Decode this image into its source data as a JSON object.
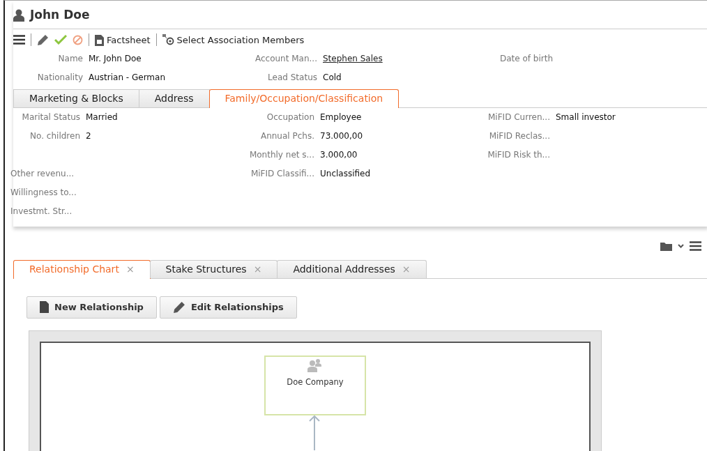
{
  "header": {
    "title": "John Doe"
  },
  "toolbar": [
    {
      "kind": "menu"
    },
    {
      "kind": "separator"
    },
    {
      "kind": "edit"
    },
    {
      "kind": "save"
    },
    {
      "kind": "cancel"
    },
    {
      "kind": "separator"
    },
    {
      "kind": "factsheet",
      "label": "Factsheet"
    },
    {
      "kind": "separator"
    },
    {
      "kind": "members",
      "label": "Select Association Members"
    }
  ],
  "header_fields": [
    [
      {
        "kind": "field",
        "label": "Name",
        "value": "Mr. John Doe"
      },
      {
        "kind": "link",
        "label": "Account Man...",
        "value": "Stephen Sales"
      },
      {
        "kind": "field",
        "label": "Date of birth"
      }
    ],
    [
      {
        "kind": "field",
        "label": "Nationality",
        "value": "Austrian - German"
      },
      {
        "kind": "field",
        "label": "Lead Status",
        "value": "Cold"
      },
      {
        "kind": "empty"
      }
    ]
  ],
  "detail_tabs": [
    {
      "label": "Marketing & Blocks",
      "selected": false
    },
    {
      "label": "Address",
      "selected": false
    },
    {
      "label": "Family/Occupation/Classification",
      "selected": true
    }
  ],
  "detail_fields": [
    [
      {
        "kind": "field",
        "label": "Marital Status",
        "value": "Married"
      },
      {
        "kind": "field",
        "label": "Occupation",
        "value": "Employee"
      },
      {
        "kind": "field",
        "label": "MiFID Curren...",
        "value": "Small investor"
      }
    ],
    [
      {
        "kind": "field",
        "label": "No. children",
        "value": "2"
      },
      {
        "kind": "field",
        "label": "Annual Pchs.",
        "value": "73.000,00"
      },
      {
        "kind": "field",
        "label": "MiFID Reclas..."
      }
    ],
    [
      {
        "kind": "empty"
      },
      {
        "kind": "field",
        "label": "Monthly net s...",
        "value": "3.000,00"
      },
      {
        "kind": "field",
        "label": "MiFID Risk th..."
      }
    ],
    [
      {
        "kind": "wide_label",
        "label": "Other revenu..."
      },
      {
        "kind": "field",
        "label": "MiFID Classifi...",
        "value": "Unclassified"
      },
      {
        "kind": "empty"
      }
    ],
    [
      {
        "kind": "wide_label",
        "label": "Willingness to..."
      },
      {
        "kind": "empty"
      },
      {
        "kind": "empty"
      }
    ],
    [
      {
        "kind": "wide_label",
        "label": "Investmt. Str..."
      },
      {
        "kind": "empty"
      },
      {
        "kind": "empty"
      }
    ]
  ],
  "related_tabs": [
    {
      "label": "Relationship Chart",
      "selected": true,
      "close": "×"
    },
    {
      "label": "Stake Structures",
      "selected": false,
      "close": "×"
    },
    {
      "label": "Additional Addresses",
      "selected": false,
      "close": "×"
    }
  ],
  "actions": [
    {
      "kind": "new",
      "label": "New Relationship"
    },
    {
      "kind": "edit",
      "label": "Edit Relationships"
    }
  ],
  "chart": {
    "nodes": [
      {
        "label": "Doe Company"
      }
    ]
  }
}
